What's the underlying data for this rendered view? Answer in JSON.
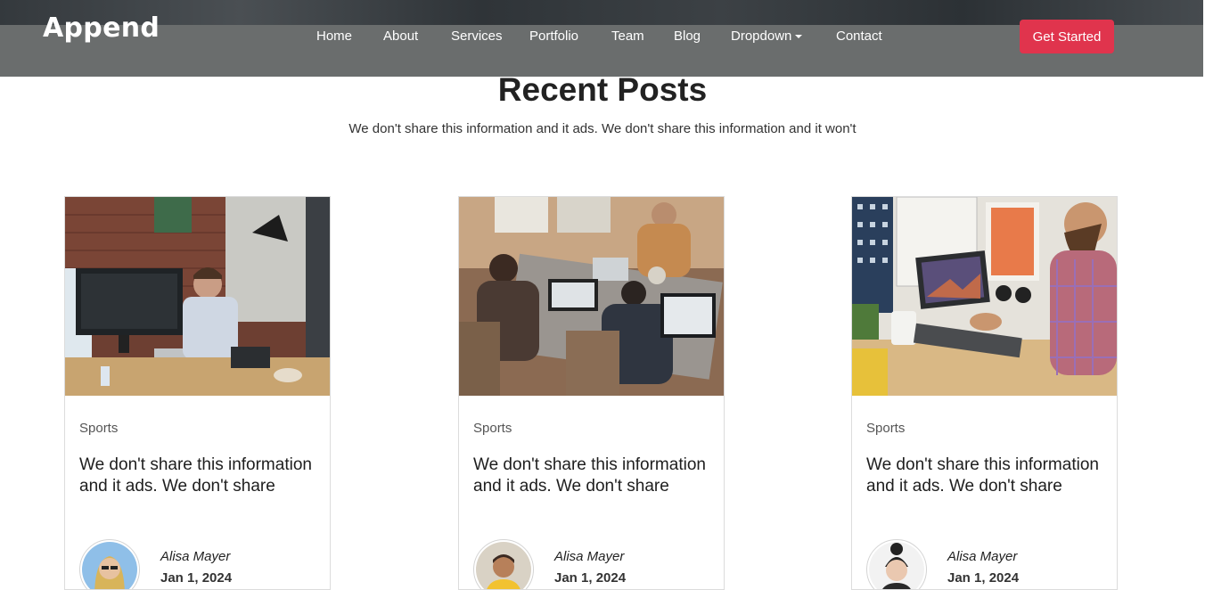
{
  "header": {
    "logo": "Append",
    "nav": [
      "Home",
      "About",
      "Services",
      "Portfolio",
      "Team",
      "Blog",
      "Dropdown",
      "Contact"
    ],
    "cta": "Get Started"
  },
  "section": {
    "title": "Recent Posts",
    "subtitle": "We don't share this information and it ads. We don't share this information and it won't"
  },
  "posts": [
    {
      "category": "Sports",
      "title": "We don't share this information and it ads. We don't share",
      "author": "Alisa Mayer",
      "date": "Jan 1, 2024"
    },
    {
      "category": "Sports",
      "title": "We don't share this information and it ads. We don't share",
      "author": "Alisa Mayer",
      "date": "Jan 1, 2024"
    },
    {
      "category": "Sports",
      "title": "We don't share this information and it ads. We don't share",
      "author": "Alisa Mayer",
      "date": "Jan 1, 2024"
    }
  ],
  "colors": {
    "accent": "#e0344d",
    "header_bg": "#6a6d6d"
  }
}
